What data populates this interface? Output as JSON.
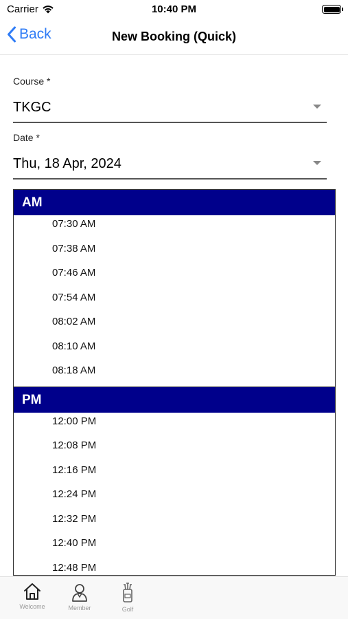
{
  "status_bar": {
    "carrier": "Carrier",
    "time": "10:40 PM"
  },
  "nav": {
    "back_label": "Back",
    "title": "New Booking (Quick)"
  },
  "form": {
    "course": {
      "label": "Course *",
      "value": "TKGC"
    },
    "date": {
      "label": "Date *",
      "value": "Thu, 18 Apr, 2024"
    }
  },
  "sections": [
    {
      "header": "AM",
      "slots": [
        "07:30 AM",
        "07:38 AM",
        "07:46 AM",
        "07:54 AM",
        "08:02 AM",
        "08:10 AM",
        "08:18 AM"
      ]
    },
    {
      "header": "PM",
      "slots": [
        "12:00 PM",
        "12:08 PM",
        "12:16 PM",
        "12:24 PM",
        "12:32 PM",
        "12:40 PM",
        "12:48 PM"
      ]
    }
  ],
  "tabs": [
    {
      "label": "Welcome",
      "icon": "home-icon"
    },
    {
      "label": "Member",
      "icon": "person-icon"
    },
    {
      "label": "Golf",
      "icon": "golf-bag-icon"
    }
  ],
  "colors": {
    "section_header_bg": "#00008b",
    "accent": "#2f7cf6"
  }
}
